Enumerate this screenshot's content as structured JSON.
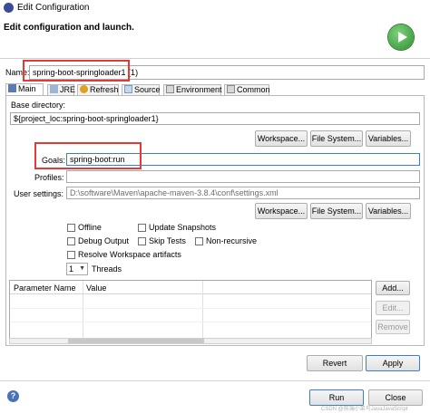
{
  "window": {
    "title": "Edit Configuration"
  },
  "header": {
    "subtitle": "Edit configuration and launch."
  },
  "name": {
    "label": "Name:",
    "value": "spring-boot-springloader1 (1)"
  },
  "tabs": [
    {
      "label": "Main",
      "icon": "main-tab-icon"
    },
    {
      "label": "JRE",
      "icon": "jre-icon"
    },
    {
      "label": "Refresh",
      "icon": "refresh-icon"
    },
    {
      "label": "Source",
      "icon": "source-icon"
    },
    {
      "label": "Environment",
      "icon": "environment-icon"
    },
    {
      "label": "Common",
      "icon": "common-icon"
    }
  ],
  "main": {
    "base_dir_label": "Base directory:",
    "base_dir_value": "${project_loc:spring-boot-springloader1}",
    "buttons1": [
      "Workspace...",
      "File System...",
      "Variables..."
    ],
    "goals_label": "Goals:",
    "goals_value": "spring-boot:run",
    "profiles_label": "Profiles:",
    "profiles_value": "",
    "user_settings_label": "User settings:",
    "user_settings_value": "D:\\software\\Maven\\apache-maven-3.8.4\\conf\\settings.xml",
    "buttons2": [
      "Workspace...",
      "File System...",
      "Variables..."
    ],
    "options": {
      "offline": "Offline",
      "update_snapshots": "Update Snapshots",
      "debug_output": "Debug Output",
      "skip_tests": "Skip Tests",
      "non_recursive": "Non-recursive",
      "resolve_workspace": "Resolve Workspace artifacts"
    },
    "threads_value": "1",
    "threads_label": "Threads",
    "table_headers": [
      "Parameter Name",
      "Value"
    ],
    "table_buttons": [
      "Add...",
      "Edit...",
      "Remove"
    ]
  },
  "footer": {
    "revert": "Revert",
    "apply": "Apply",
    "run": "Run",
    "close": "Close",
    "help": "?",
    "watermark": "CSDN @前端小菜鸟JavaJavaScript"
  },
  "colors": {
    "highlight": "#e53935",
    "run_green": "#3aa93a",
    "field_focus": "#3c7fc5"
  }
}
